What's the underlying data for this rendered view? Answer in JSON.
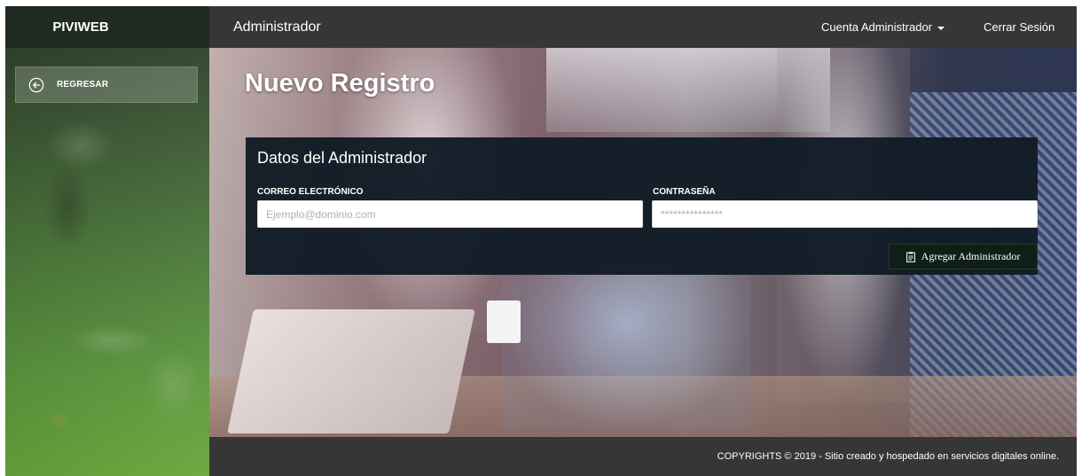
{
  "sidebar": {
    "brand": "PIVIWEB",
    "back_button": {
      "label": "REGRESAR",
      "icon": "circle-arrow-left-icon"
    }
  },
  "topbar": {
    "title": "Administrador",
    "account_menu": "Cuenta Administrador",
    "logout": "Cerrar Sesión"
  },
  "main": {
    "heading": "Nuevo Registro",
    "card": {
      "title": "Datos del Administrador",
      "email": {
        "label": "CORREO ELECTRÓNICO",
        "placeholder": "Ejemplo@dominio.com",
        "value": ""
      },
      "password": {
        "label": "CONTRASEÑA",
        "placeholder": "***************",
        "value": ""
      },
      "submit_label": "Agregar Administrador",
      "submit_icon": "clipboard-icon"
    }
  },
  "footer": {
    "copyright": "COPYRIGHTS © 2019 - Sitio creado y hospedado en servicios digitales online."
  },
  "colors": {
    "topbar": "#363636",
    "card": "#121c26",
    "button": "#0f1f18",
    "sidebar_green": "#5e9a3f"
  }
}
